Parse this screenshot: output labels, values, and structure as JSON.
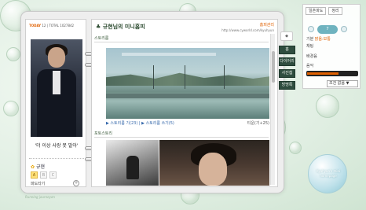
{
  "left": {
    "today_label": "TODAY",
    "today_count": "12 | TOTAL 1027842",
    "caption": "'더 이상 사랑 못 말아'",
    "owner_name": "규현",
    "icons": [
      "A",
      "B",
      "C"
    ],
    "friends_label": "파도타기",
    "friends_button": "+",
    "footer": "Running journeyen"
  },
  "main": {
    "title": "♣ 규현님의 미니홈피",
    "edit_label": "홈피관리",
    "url": "http://www.cyworld.com/kyuhyun",
    "section1_title": "스토리룸",
    "links_left": "▶ 스토리룸 기(23) | ▶ 스토리룸 쓰기(5)",
    "links_right": "티운(기+25)",
    "section2_title": "포토스토리"
  },
  "nav": {
    "top_icon": "◆",
    "tabs": [
      "홈",
      "다이어리",
      "사진첩",
      "방명록"
    ]
  },
  "widget": {
    "tab1": "일촌파도",
    "tab2": "정리",
    "pill": "7",
    "row1": "기분",
    "row1_val": "맑음:보통",
    "row2": "채팅",
    "row3": "배경음",
    "row4": "음악",
    "select_value": "조건 없음 ▼"
  },
  "logo": {
    "text": "Kyuhyun's mini homepage"
  },
  "colors": {
    "accent": "#e06000",
    "nav_tab": "#2f4d3f",
    "background": "#e3f0e5"
  }
}
